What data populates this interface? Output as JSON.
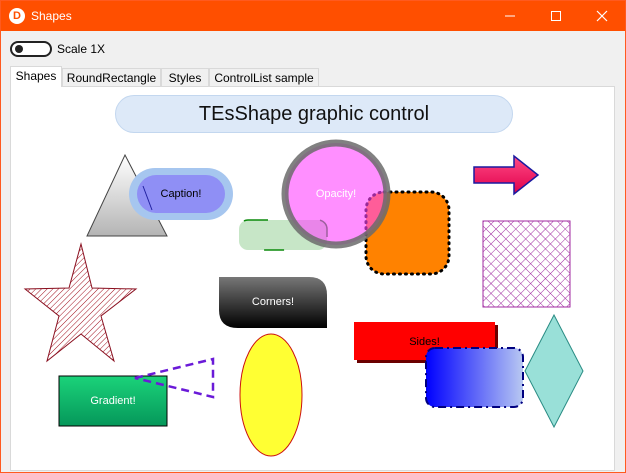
{
  "window": {
    "title": "Shapes",
    "app_icon_letter": "D",
    "accent_color": "#ff4f00"
  },
  "toolbar": {
    "scale_toggle_label": "Scale 1X",
    "scale_toggle_on": false
  },
  "tabs": [
    {
      "label": "Shapes",
      "active": true
    },
    {
      "label": "RoundRectangle",
      "active": false
    },
    {
      "label": "Styles",
      "active": false
    },
    {
      "label": "ControlList sample",
      "active": false
    }
  ],
  "canvas": {
    "header": "TEsShape graphic control",
    "shapes": {
      "caption": "Caption!",
      "opacity": "Opacity!",
      "corners": "Corners!",
      "sides": "Sides!",
      "gradient": "Gradient!"
    }
  }
}
